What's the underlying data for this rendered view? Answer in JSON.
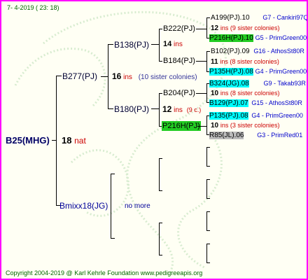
{
  "header": {
    "date": "7-   4-2019  ( 23:  18)"
  },
  "footer": {
    "copyright": "Copyright 2004-2019 @ Karl Kehrle Foundation   www.pedigreeapis.org"
  },
  "root": {
    "name": "B25(MHG)",
    "num": "18",
    "label": "nat"
  },
  "gen1": {
    "top": {
      "name": "B277(PJ)",
      "num": "16",
      "label": "ins",
      "note": "(10 sister colonies)"
    },
    "bottom": {
      "name": "Bmixx18(JG)",
      "note": "no more"
    }
  },
  "gen2": {
    "top": {
      "name": "B138(PJ)"
    },
    "mid": {
      "name": "B180(PJ)",
      "num": "12",
      "label": "ins",
      "note": "(9 c.)"
    }
  },
  "gen3": {
    "a": {
      "name": "B222(PJ)"
    },
    "a_num": {
      "num": "14",
      "label": "ins"
    },
    "b": {
      "name": "B184(PJ)"
    },
    "c": {
      "name": "B204(PJ)"
    },
    "d": {
      "name": "P216H(PJ)"
    }
  },
  "gen4": {
    "r1": {
      "name": "A199(PJ).10",
      "code": "G7 - Cankiri97Q"
    },
    "r1n": {
      "num": "12",
      "text": "ins (9 sister colonies)"
    },
    "r2": {
      "name": "P216H(PJ).10",
      "code": "G5 - PrimGreen00"
    },
    "r3": {
      "name": "B102(PJ).09",
      "code": "G16 - AthosSt80R"
    },
    "r3n": {
      "num": "11",
      "text": "ins (8 sister colonies)"
    },
    "r4": {
      "name": "P135H(PJ).08",
      "code": "G4 - PrimGreen00"
    },
    "r5": {
      "name": "B324(JG).08",
      "code": "G9 - Takab93R"
    },
    "r5n": {
      "num": "10",
      "text": "ins (8 sister colonies)"
    },
    "r6": {
      "name": "B129(PJ).07",
      "code": "G15 - AthosSt80R"
    },
    "r7": {
      "name": "P135(PJ).08",
      "code": "G4 - PrimGreen00"
    },
    "r7n": {
      "num": "10",
      "text": "ins (3 sister colonies)"
    },
    "r8": {
      "name": "R85(JL).06",
      "code": "G3 - PrimRed01"
    }
  }
}
